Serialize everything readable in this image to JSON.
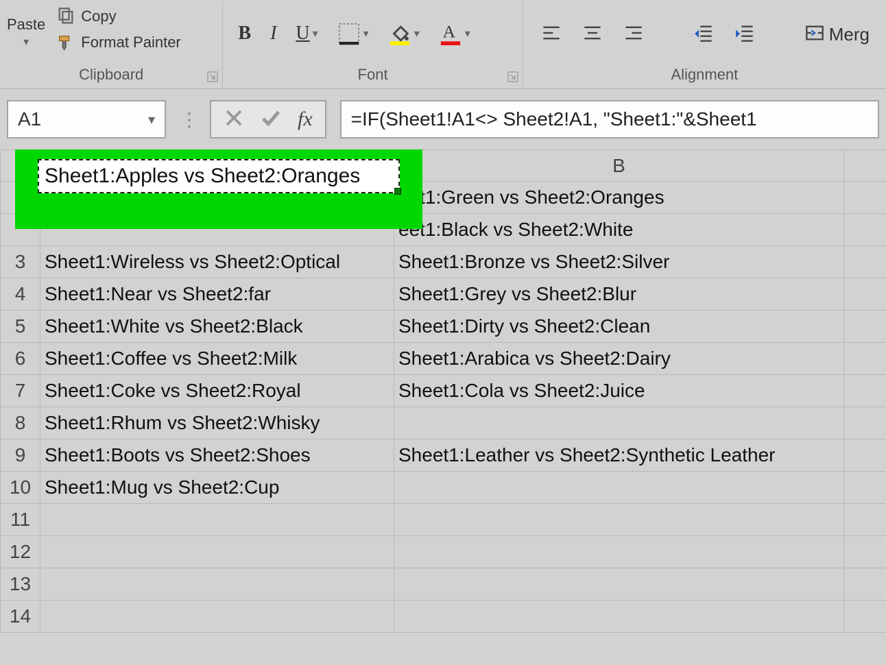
{
  "ribbon": {
    "clipboard": {
      "paste": "Paste",
      "copy": "Copy",
      "format_painter": "Format Painter",
      "group_label": "Clipboard"
    },
    "font": {
      "bold": "B",
      "italic": "I",
      "underline": "U",
      "group_label": "Font"
    },
    "alignment": {
      "merge": "Merg",
      "group_label": "Alignment"
    }
  },
  "name_box": {
    "value": "A1"
  },
  "formula_bar": {
    "fx": "fx",
    "value": "=IF(Sheet1!A1<> Sheet2!A1, \"Sheet1:\"&Sheet1"
  },
  "columns": [
    "",
    "B"
  ],
  "highlight_cell": "Sheet1:Apples vs Sheet2:Oranges",
  "rows": [
    {
      "n": "",
      "a": "",
      "b": "eet1:Green vs Sheet2:Oranges"
    },
    {
      "n": "",
      "a": "",
      "b": "eet1:Black vs Sheet2:White"
    },
    {
      "n": "3",
      "a": "Sheet1:Wireless vs Sheet2:Optical",
      "b": "Sheet1:Bronze vs Sheet2:Silver"
    },
    {
      "n": "4",
      "a": "Sheet1:Near vs Sheet2:far",
      "b": "Sheet1:Grey vs Sheet2:Blur"
    },
    {
      "n": "5",
      "a": "Sheet1:White vs Sheet2:Black",
      "b": "Sheet1:Dirty vs Sheet2:Clean"
    },
    {
      "n": "6",
      "a": "Sheet1:Coffee vs Sheet2:Milk",
      "b": "Sheet1:Arabica vs Sheet2:Dairy"
    },
    {
      "n": "7",
      "a": "Sheet1:Coke vs Sheet2:Royal",
      "b": "Sheet1:Cola vs Sheet2:Juice"
    },
    {
      "n": "8",
      "a": "Sheet1:Rhum vs Sheet2:Whisky",
      "b": ""
    },
    {
      "n": "9",
      "a": "Sheet1:Boots vs Sheet2:Shoes",
      "b": "Sheet1:Leather vs Sheet2:Synthetic Leather"
    },
    {
      "n": "10",
      "a": "Sheet1:Mug vs Sheet2:Cup",
      "b": ""
    },
    {
      "n": "11",
      "a": "",
      "b": ""
    },
    {
      "n": "12",
      "a": "",
      "b": ""
    },
    {
      "n": "13",
      "a": "",
      "b": ""
    },
    {
      "n": "14",
      "a": "",
      "b": ""
    }
  ]
}
